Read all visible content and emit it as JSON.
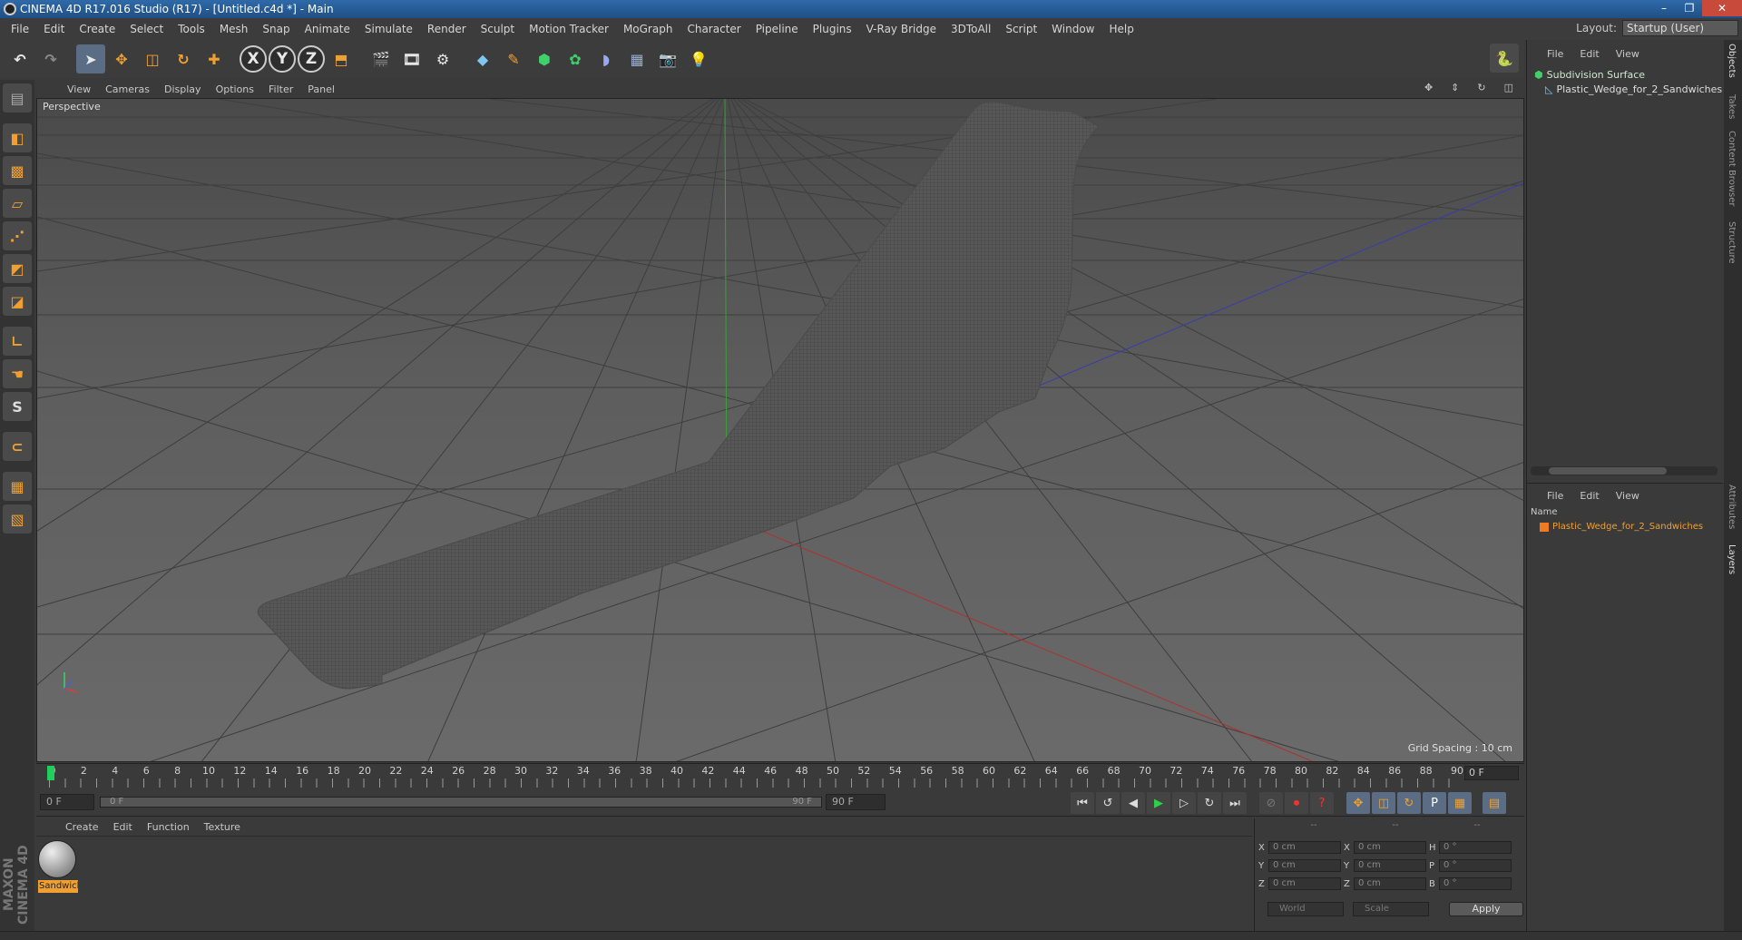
{
  "window": {
    "title": "CINEMA 4D R17.016 Studio (R17) - [Untitled.c4d *] - Main",
    "controls": [
      "–",
      "❐",
      "✕"
    ]
  },
  "menu": [
    "File",
    "Edit",
    "Create",
    "Select",
    "Tools",
    "Mesh",
    "Snap",
    "Animate",
    "Simulate",
    "Render",
    "Sculpt",
    "Motion Tracker",
    "MoGraph",
    "Character",
    "Pipeline",
    "Plugins",
    "V-Ray Bridge",
    "3DToAll",
    "Script",
    "Window",
    "Help"
  ],
  "layout": {
    "label": "Layout:",
    "value": "Startup (User)"
  },
  "toolbar": {
    "x": "X",
    "y": "Y",
    "z": "Z"
  },
  "viewport": {
    "menu": [
      "View",
      "Cameras",
      "Display",
      "Options",
      "Filter",
      "Panel"
    ],
    "label": "Perspective",
    "grid_spacing": "Grid Spacing : 10 cm"
  },
  "timeline": {
    "ticks": [
      "0",
      "2",
      "4",
      "6",
      "8",
      "10",
      "12",
      "14",
      "16",
      "18",
      "20",
      "22",
      "24",
      "26",
      "28",
      "30",
      "32",
      "34",
      "36",
      "38",
      "40",
      "42",
      "44",
      "46",
      "48",
      "50",
      "52",
      "54",
      "56",
      "58",
      "60",
      "62",
      "64",
      "66",
      "68",
      "70",
      "72",
      "74",
      "76",
      "78",
      "80",
      "82",
      "84",
      "86",
      "88",
      "90"
    ],
    "current": "0 F",
    "start": "0 F",
    "range_start": "0 F",
    "range_end": "90 F",
    "end": "90 F"
  },
  "materials": {
    "menu": [
      "Create",
      "Edit",
      "Function",
      "Texture"
    ],
    "item": "Sandwich"
  },
  "coords": {
    "headers": [
      "--",
      "--",
      "--"
    ],
    "rows": [
      {
        "a": "X",
        "av": "0 cm",
        "b": "X",
        "bv": "0 cm",
        "c": "H",
        "cv": "0 °"
      },
      {
        "a": "Y",
        "av": "0 cm",
        "b": "Y",
        "bv": "0 cm",
        "c": "P",
        "cv": "0 °"
      },
      {
        "a": "Z",
        "av": "0 cm",
        "b": "Z",
        "bv": "0 cm",
        "c": "B",
        "cv": "0 °"
      }
    ],
    "space": "World",
    "mode": "Scale",
    "apply": "Apply"
  },
  "objects": {
    "menu": [
      "File",
      "Edit",
      "View"
    ],
    "items": [
      "Subdivision Surface",
      "Plastic_Wedge_for_2_Sandwiches"
    ]
  },
  "layers": {
    "menu": [
      "File",
      "Edit",
      "View"
    ],
    "name_header": "Name",
    "item": "Plastic_Wedge_for_2_Sandwiches"
  },
  "sidetabs": [
    "Objects",
    "Takes",
    "Content Browser",
    "Structure",
    "Attributes",
    "Layers"
  ],
  "brand": "MAXON CINEMA 4D"
}
